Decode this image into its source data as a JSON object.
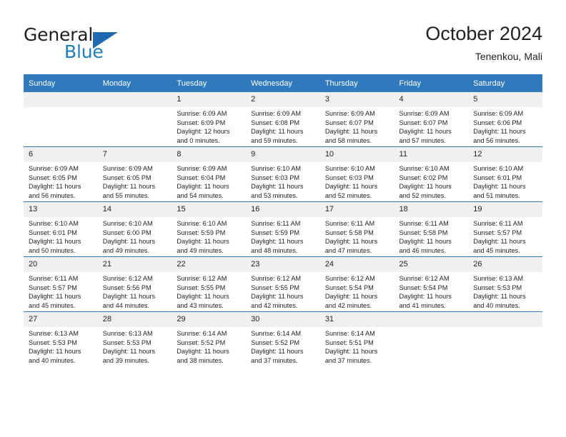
{
  "brand": {
    "name_top": "General",
    "name_bottom": "Blue",
    "color_dark": "#231f20",
    "color_blue": "#1a7fc1",
    "triangle_color": "#1f69b3"
  },
  "header": {
    "title": "October 2024",
    "subtitle": "Tenenkou, Mali",
    "accent_color": "#3079bd"
  },
  "calendar": {
    "weekday_headers": [
      "Sunday",
      "Monday",
      "Tuesday",
      "Wednesday",
      "Thursday",
      "Friday",
      "Saturday"
    ],
    "labels": {
      "sunrise": "Sunrise:",
      "sunset": "Sunset:",
      "daylight": "Daylight:"
    },
    "weeks": [
      [
        {
          "day": "",
          "blank": true
        },
        {
          "day": "",
          "blank": true
        },
        {
          "day": "1",
          "sunrise": "Sunrise: 6:09 AM",
          "sunset": "Sunset: 6:09 PM",
          "daylight1": "Daylight: 12 hours",
          "daylight2": "and 0 minutes."
        },
        {
          "day": "2",
          "sunrise": "Sunrise: 6:09 AM",
          "sunset": "Sunset: 6:08 PM",
          "daylight1": "Daylight: 11 hours",
          "daylight2": "and 59 minutes."
        },
        {
          "day": "3",
          "sunrise": "Sunrise: 6:09 AM",
          "sunset": "Sunset: 6:07 PM",
          "daylight1": "Daylight: 11 hours",
          "daylight2": "and 58 minutes."
        },
        {
          "day": "4",
          "sunrise": "Sunrise: 6:09 AM",
          "sunset": "Sunset: 6:07 PM",
          "daylight1": "Daylight: 11 hours",
          "daylight2": "and 57 minutes."
        },
        {
          "day": "5",
          "sunrise": "Sunrise: 6:09 AM",
          "sunset": "Sunset: 6:06 PM",
          "daylight1": "Daylight: 11 hours",
          "daylight2": "and 56 minutes."
        }
      ],
      [
        {
          "day": "6",
          "sunrise": "Sunrise: 6:09 AM",
          "sunset": "Sunset: 6:05 PM",
          "daylight1": "Daylight: 11 hours",
          "daylight2": "and 56 minutes."
        },
        {
          "day": "7",
          "sunrise": "Sunrise: 6:09 AM",
          "sunset": "Sunset: 6:05 PM",
          "daylight1": "Daylight: 11 hours",
          "daylight2": "and 55 minutes."
        },
        {
          "day": "8",
          "sunrise": "Sunrise: 6:09 AM",
          "sunset": "Sunset: 6:04 PM",
          "daylight1": "Daylight: 11 hours",
          "daylight2": "and 54 minutes."
        },
        {
          "day": "9",
          "sunrise": "Sunrise: 6:10 AM",
          "sunset": "Sunset: 6:03 PM",
          "daylight1": "Daylight: 11 hours",
          "daylight2": "and 53 minutes."
        },
        {
          "day": "10",
          "sunrise": "Sunrise: 6:10 AM",
          "sunset": "Sunset: 6:03 PM",
          "daylight1": "Daylight: 11 hours",
          "daylight2": "and 52 minutes."
        },
        {
          "day": "11",
          "sunrise": "Sunrise: 6:10 AM",
          "sunset": "Sunset: 6:02 PM",
          "daylight1": "Daylight: 11 hours",
          "daylight2": "and 52 minutes."
        },
        {
          "day": "12",
          "sunrise": "Sunrise: 6:10 AM",
          "sunset": "Sunset: 6:01 PM",
          "daylight1": "Daylight: 11 hours",
          "daylight2": "and 51 minutes."
        }
      ],
      [
        {
          "day": "13",
          "sunrise": "Sunrise: 6:10 AM",
          "sunset": "Sunset: 6:01 PM",
          "daylight1": "Daylight: 11 hours",
          "daylight2": "and 50 minutes."
        },
        {
          "day": "14",
          "sunrise": "Sunrise: 6:10 AM",
          "sunset": "Sunset: 6:00 PM",
          "daylight1": "Daylight: 11 hours",
          "daylight2": "and 49 minutes."
        },
        {
          "day": "15",
          "sunrise": "Sunrise: 6:10 AM",
          "sunset": "Sunset: 5:59 PM",
          "daylight1": "Daylight: 11 hours",
          "daylight2": "and 49 minutes."
        },
        {
          "day": "16",
          "sunrise": "Sunrise: 6:11 AM",
          "sunset": "Sunset: 5:59 PM",
          "daylight1": "Daylight: 11 hours",
          "daylight2": "and 48 minutes."
        },
        {
          "day": "17",
          "sunrise": "Sunrise: 6:11 AM",
          "sunset": "Sunset: 5:58 PM",
          "daylight1": "Daylight: 11 hours",
          "daylight2": "and 47 minutes."
        },
        {
          "day": "18",
          "sunrise": "Sunrise: 6:11 AM",
          "sunset": "Sunset: 5:58 PM",
          "daylight1": "Daylight: 11 hours",
          "daylight2": "and 46 minutes."
        },
        {
          "day": "19",
          "sunrise": "Sunrise: 6:11 AM",
          "sunset": "Sunset: 5:57 PM",
          "daylight1": "Daylight: 11 hours",
          "daylight2": "and 45 minutes."
        }
      ],
      [
        {
          "day": "20",
          "sunrise": "Sunrise: 6:11 AM",
          "sunset": "Sunset: 5:57 PM",
          "daylight1": "Daylight: 11 hours",
          "daylight2": "and 45 minutes."
        },
        {
          "day": "21",
          "sunrise": "Sunrise: 6:12 AM",
          "sunset": "Sunset: 5:56 PM",
          "daylight1": "Daylight: 11 hours",
          "daylight2": "and 44 minutes."
        },
        {
          "day": "22",
          "sunrise": "Sunrise: 6:12 AM",
          "sunset": "Sunset: 5:55 PM",
          "daylight1": "Daylight: 11 hours",
          "daylight2": "and 43 minutes."
        },
        {
          "day": "23",
          "sunrise": "Sunrise: 6:12 AM",
          "sunset": "Sunset: 5:55 PM",
          "daylight1": "Daylight: 11 hours",
          "daylight2": "and 42 minutes."
        },
        {
          "day": "24",
          "sunrise": "Sunrise: 6:12 AM",
          "sunset": "Sunset: 5:54 PM",
          "daylight1": "Daylight: 11 hours",
          "daylight2": "and 42 minutes."
        },
        {
          "day": "25",
          "sunrise": "Sunrise: 6:12 AM",
          "sunset": "Sunset: 5:54 PM",
          "daylight1": "Daylight: 11 hours",
          "daylight2": "and 41 minutes."
        },
        {
          "day": "26",
          "sunrise": "Sunrise: 6:13 AM",
          "sunset": "Sunset: 5:53 PM",
          "daylight1": "Daylight: 11 hours",
          "daylight2": "and 40 minutes."
        }
      ],
      [
        {
          "day": "27",
          "sunrise": "Sunrise: 6:13 AM",
          "sunset": "Sunset: 5:53 PM",
          "daylight1": "Daylight: 11 hours",
          "daylight2": "and 40 minutes."
        },
        {
          "day": "28",
          "sunrise": "Sunrise: 6:13 AM",
          "sunset": "Sunset: 5:53 PM",
          "daylight1": "Daylight: 11 hours",
          "daylight2": "and 39 minutes."
        },
        {
          "day": "29",
          "sunrise": "Sunrise: 6:14 AM",
          "sunset": "Sunset: 5:52 PM",
          "daylight1": "Daylight: 11 hours",
          "daylight2": "and 38 minutes."
        },
        {
          "day": "30",
          "sunrise": "Sunrise: 6:14 AM",
          "sunset": "Sunset: 5:52 PM",
          "daylight1": "Daylight: 11 hours",
          "daylight2": "and 37 minutes."
        },
        {
          "day": "31",
          "sunrise": "Sunrise: 6:14 AM",
          "sunset": "Sunset: 5:51 PM",
          "daylight1": "Daylight: 11 hours",
          "daylight2": "and 37 minutes."
        },
        {
          "day": "",
          "blank": true
        },
        {
          "day": "",
          "blank": true
        }
      ]
    ]
  }
}
